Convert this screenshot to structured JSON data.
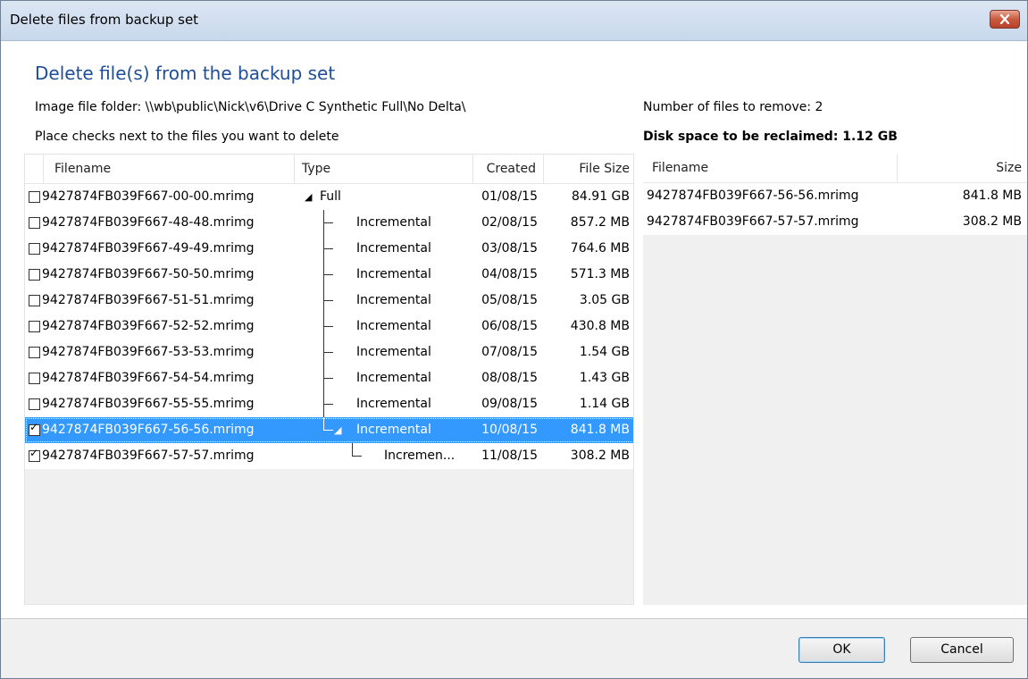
{
  "window": {
    "title": "Delete files from backup set",
    "close_icon": "close-icon"
  },
  "heading": "Delete file(s) from the backup set",
  "image_folder_label": "Image file folder: \\\\wb\\public\\Nick\\v6\\Drive C Synthetic Full\\No Delta\\",
  "instructions": "Place checks next to the files you want to delete",
  "summary": {
    "files_to_remove": "Number of files to remove: 2",
    "disk_space": "Disk space to be reclaimed: 1.12 GB"
  },
  "left_list": {
    "columns": [
      "Filename",
      "Type",
      "Created",
      "File Size"
    ],
    "rows": [
      {
        "filename": "9427874FB039F667-00-00.mrimg",
        "type": "Full",
        "created": "01/08/15",
        "size": "84.91 GB",
        "checked": false
      },
      {
        "filename": "9427874FB039F667-48-48.mrimg",
        "type": "Incremental",
        "created": "02/08/15",
        "size": "857.2 MB",
        "checked": false
      },
      {
        "filename": "9427874FB039F667-49-49.mrimg",
        "type": "Incremental",
        "created": "03/08/15",
        "size": "764.6 MB",
        "checked": false
      },
      {
        "filename": "9427874FB039F667-50-50.mrimg",
        "type": "Incremental",
        "created": "04/08/15",
        "size": "571.3 MB",
        "checked": false
      },
      {
        "filename": "9427874FB039F667-51-51.mrimg",
        "type": "Incremental",
        "created": "05/08/15",
        "size": "3.05 GB",
        "checked": false
      },
      {
        "filename": "9427874FB039F667-52-52.mrimg",
        "type": "Incremental",
        "created": "06/08/15",
        "size": "430.8 MB",
        "checked": false
      },
      {
        "filename": "9427874FB039F667-53-53.mrimg",
        "type": "Incremental",
        "created": "07/08/15",
        "size": "1.54 GB",
        "checked": false
      },
      {
        "filename": "9427874FB039F667-54-54.mrimg",
        "type": "Incremental",
        "created": "08/08/15",
        "size": "1.43 GB",
        "checked": false
      },
      {
        "filename": "9427874FB039F667-55-55.mrimg",
        "type": "Incremental",
        "created": "09/08/15",
        "size": "1.14 GB",
        "checked": false
      },
      {
        "filename": "9427874FB039F667-56-56.mrimg",
        "type": "Incremental",
        "created": "10/08/15",
        "size": "841.8 MB",
        "checked": true,
        "selected": true
      },
      {
        "filename": "9427874FB039F667-57-57.mrimg",
        "type": "Incremen...",
        "created": "11/08/15",
        "size": "308.2 MB",
        "checked": true
      }
    ]
  },
  "right_list": {
    "columns": [
      "Filename",
      "Size"
    ],
    "rows": [
      {
        "filename": "9427874FB039F667-56-56.mrimg",
        "size": "841.8 MB"
      },
      {
        "filename": "9427874FB039F667-57-57.mrimg",
        "size": "308.2 MB"
      }
    ]
  },
  "buttons": {
    "ok": "OK",
    "cancel": "Cancel"
  },
  "colors": {
    "heading": "#1e4e98",
    "selection": "#3399ff"
  }
}
